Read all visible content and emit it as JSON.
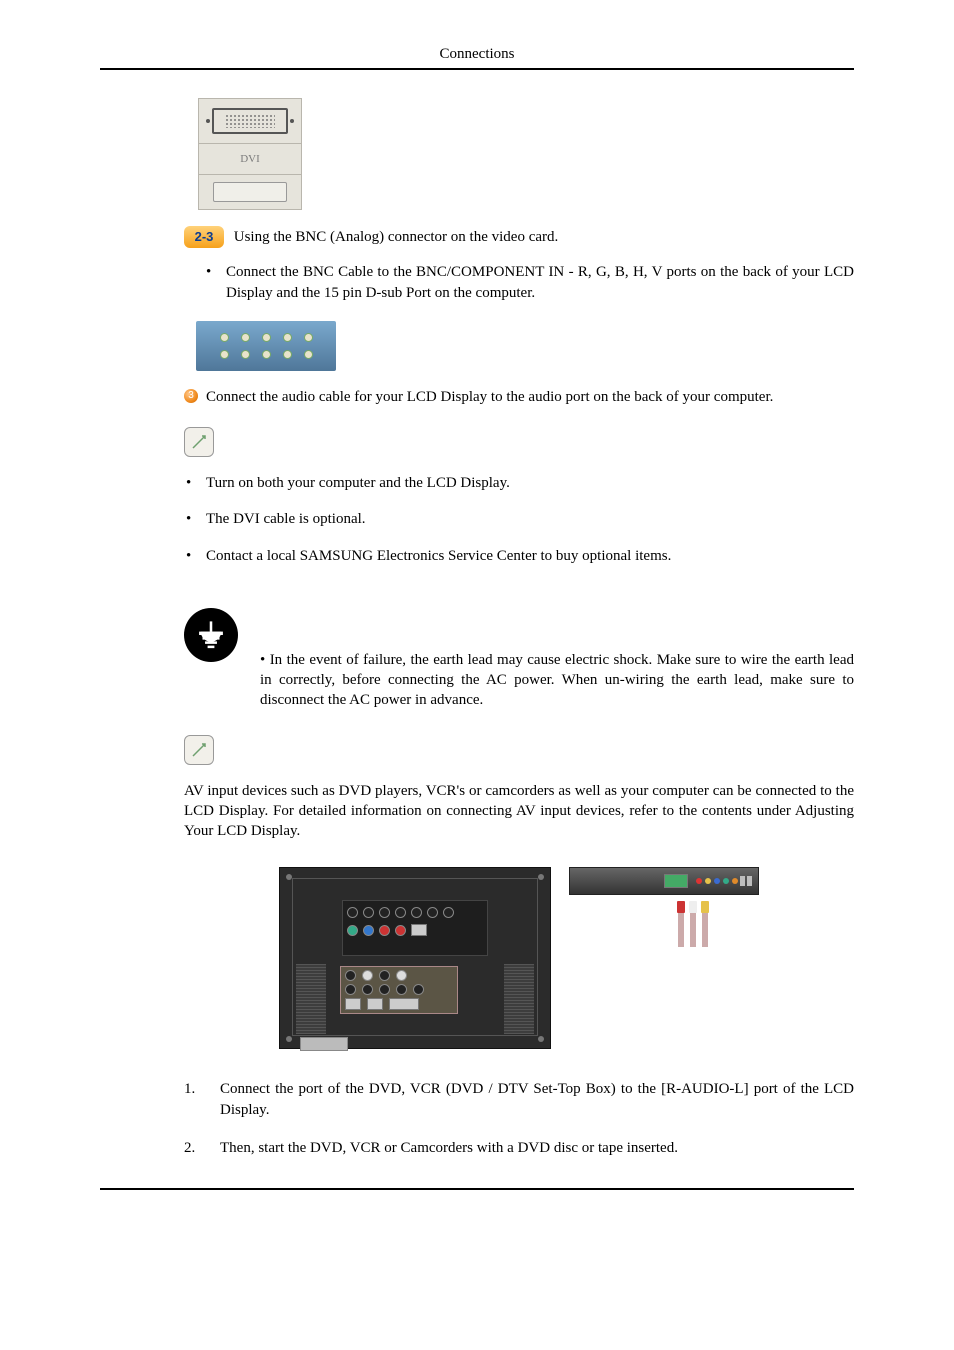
{
  "header": {
    "title": "Connections"
  },
  "dvi": {
    "label": "DVI"
  },
  "step23": {
    "badge": "2-3",
    "text": "Using the BNC (Analog) connector on the video card."
  },
  "step23_sub": {
    "bullet1": "Connect the BNC Cable to the BNC/COMPONENT IN - R, G, B, H, V ports on the back of your LCD Display and the 15 pin D-sub Port on the computer."
  },
  "step3": {
    "badge": "3",
    "text": "Connect the audio cable for your LCD Display to the audio port on the back of your computer."
  },
  "notes1": {
    "items": [
      "Turn on both your computer and the LCD Display.",
      "The DVI cable is optional.",
      "Contact a local SAMSUNG Electronics Service Center to buy optional items."
    ]
  },
  "ground": {
    "text": "In the event of failure, the earth lead may cause electric shock. Make sure to wire the earth lead in correctly, before connecting the AC power. When un-wiring the earth lead, make sure to disconnect the AC power in advance."
  },
  "av_paragraph": "AV input devices such as DVD players, VCR's or camcorders as well as your computer can be connected to the LCD Display. For detailed information on connecting AV input devices, refer to the contents under Adjusting Your LCD Display.",
  "numbered": {
    "items": [
      "Connect the port of the DVD, VCR (DVD / DTV Set-Top Box) to the [R-AUDIO-L] port of the LCD Display.",
      "Then, start the DVD, VCR or Camcorders with a DVD disc or tape inserted."
    ]
  }
}
